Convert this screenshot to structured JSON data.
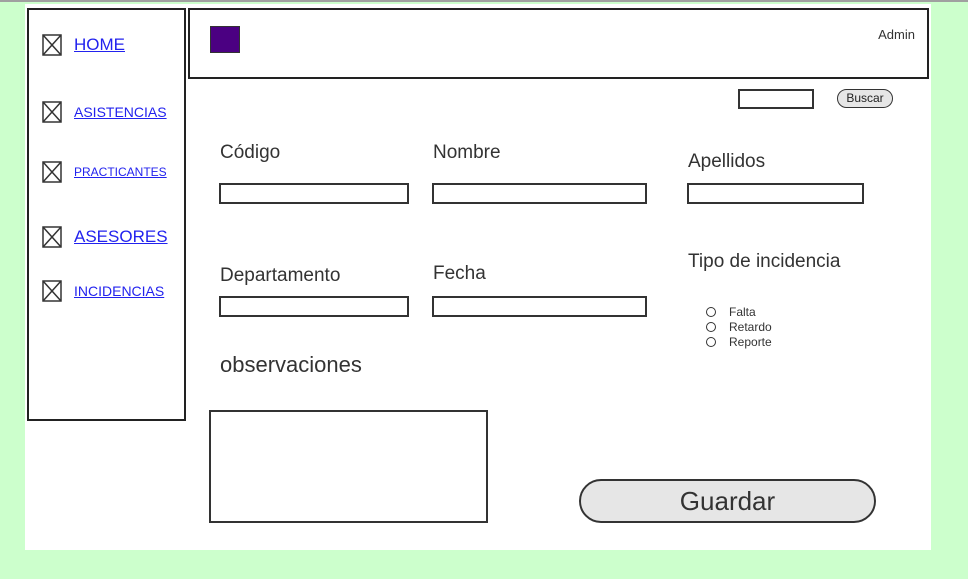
{
  "sidebar": {
    "items": [
      {
        "label": "HOME"
      },
      {
        "label": "ASISTENCIAS"
      },
      {
        "label": "PRACTICANTES"
      },
      {
        "label": "ASESORES"
      },
      {
        "label": "INCIDENCIAS"
      }
    ]
  },
  "header": {
    "user": "Admin",
    "logo_color": "#4b0082"
  },
  "search": {
    "button_label": "Buscar",
    "value": ""
  },
  "form": {
    "codigo_label": "Código",
    "nombre_label": "Nombre",
    "apellidos_label": "Apellidos",
    "departamento_label": "Departamento",
    "fecha_label": "Fecha",
    "tipo_label": "Tipo de incidencia",
    "tipo_options": [
      "Falta",
      "Retardo",
      "Reporte"
    ],
    "observaciones_label": "observaciones",
    "save_label": "Guardar"
  },
  "colors": {
    "background": "#ccffcc",
    "link": "#2222ee"
  }
}
